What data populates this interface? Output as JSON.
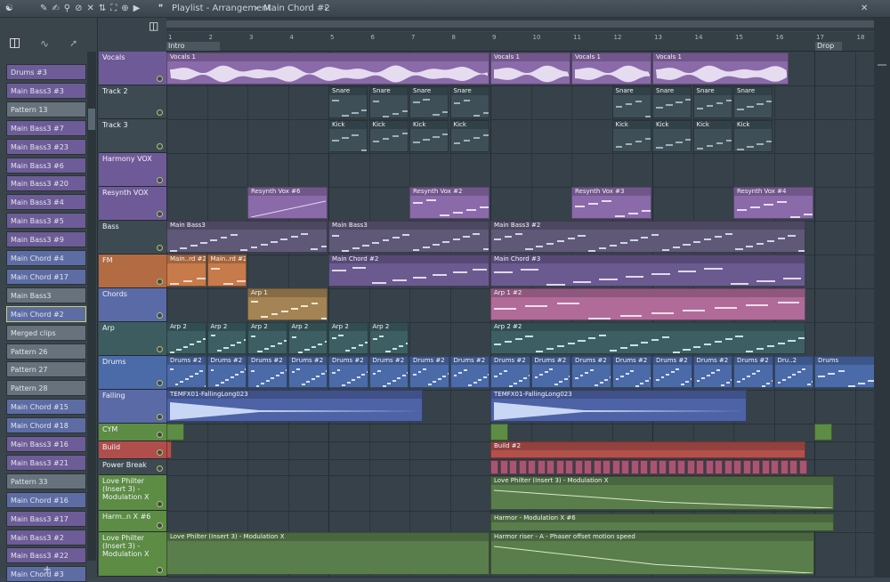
{
  "titlebar": {
    "title": "Playlist - Arrangement",
    "crumb": "Main Chord #2"
  },
  "picker_labels": {
    "bottom": "+"
  },
  "ruler": {
    "ticks": [
      "1",
      "2",
      "3",
      "4",
      "5",
      "6",
      "7",
      "8",
      "9",
      "10",
      "11",
      "12",
      "13",
      "14",
      "15",
      "16",
      "17",
      "18"
    ],
    "markers": [
      "Intro",
      "Drop"
    ]
  },
  "picker": [
    "Drums #3",
    "Main Bass3 #3",
    "Pattern 13",
    "Main Bass3 #7",
    "Main Bass3 #23",
    "Main Bass3 #6",
    "Main Bass3 #20",
    "Main Bass3 #4",
    "Main Bass3 #5",
    "Main Bass3 #9",
    "Main Chord #4",
    "Main Chord #17",
    "Main Bass3",
    "Main Chord #2",
    "Merged clips",
    "Pattern 26",
    "Pattern 27",
    "Pattern 28",
    "Main Chord #15",
    "Main Chord #18",
    "Main Bass3 #16",
    "Main Bass3 #21",
    "Pattern 33",
    "Main Chord #16",
    "Main Bass3 #17",
    "Main Bass3 #2",
    "Main Bass3 #22",
    "Main Chord #3"
  ],
  "tracks": [
    "Vocals",
    "Track 2",
    "Track 3",
    "Harmony VOX",
    "Resynth VOX",
    "Bass",
    "FM",
    "Chords",
    "Arp",
    "Drums",
    "Falling",
    "CYM",
    "Build",
    "Power Break",
    "Love Philter (Insert 3) - Modulation X",
    "Harm..n X #6",
    "Love Philter (Insert 3) - Modulation X"
  ],
  "clips": {
    "vocals": [
      "Vocals 1",
      "Vocals 1",
      "Vocals 1",
      "Vocals 1"
    ],
    "snare": "Snare",
    "kick": "Kick",
    "resynth": [
      "Resynth Vox #6",
      "Resynth Vox #2",
      "Resynth Vox #3",
      "Resynth Vox #4"
    ],
    "bass": [
      "Main Bass3",
      "Main Bass3",
      "Main Bass3 #2"
    ],
    "fm": [
      "Main..rd #2",
      "Main..rd #2",
      "Main Chord #2",
      "Main Chord #3"
    ],
    "chords": [
      "Arp 1",
      "Arp 1 #2"
    ],
    "arp": [
      "Arp 2",
      "Arp 2",
      "Arp 2",
      "Arp 2",
      "Arp 2",
      "Arp 2",
      "Arp 2 #2"
    ],
    "drums": "Drums #2",
    "drums_end": "Dru..2",
    "drums_last": "Drums",
    "falling": [
      "TEMFX01-FallingLong023",
      "TEMFX01-FallingLong023"
    ],
    "build": "Build #2",
    "auto1": "Love Philter (Insert 3) - Modulation X",
    "harm": "Harmor - Modulation X #6",
    "auto2": "Love Philter (Insert 3) - Modulation X",
    "auto3": "Harmor riser - A - Phaser offset motion speed"
  },
  "colors": {
    "purple": "#7a5c9c",
    "teal": "#3d5f63",
    "bluep": "#5a6aa6",
    "orange": "#c77a4a",
    "green": "#5d8c45",
    "red": "#b3504c",
    "drum": "#4b6aa8"
  }
}
